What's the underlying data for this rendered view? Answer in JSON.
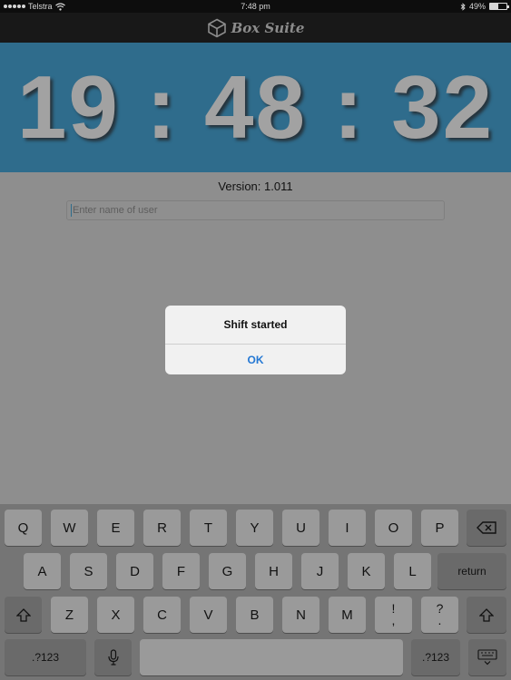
{
  "status_bar": {
    "carrier": "Telstra",
    "time": "7:48 pm",
    "battery": "49%",
    "battery_level": 0.49
  },
  "navbar": {
    "app_name": "Box Suite"
  },
  "clock": {
    "display": "19 : 48 : 32"
  },
  "main": {
    "version": "Version: 1.011",
    "user_placeholder": "Enter name of user"
  },
  "alert": {
    "message": "Shift started",
    "ok_label": "OK"
  },
  "keyboard": {
    "row1": [
      "Q",
      "W",
      "E",
      "R",
      "T",
      "Y",
      "U",
      "I",
      "O",
      "P"
    ],
    "row2": [
      "A",
      "S",
      "D",
      "F",
      "G",
      "H",
      "J",
      "K",
      "L"
    ],
    "row3": [
      "Z",
      "X",
      "C",
      "V",
      "B",
      "N",
      "M"
    ],
    "return_label": "return",
    "exclaim_top": "!",
    "exclaim_bottom": ",",
    "question_top": "?",
    "question_bottom": ".",
    "numbers_left": ".?123",
    "numbers_right": ".?123",
    "icons": {
      "delete": "delete-icon",
      "shift_left": "shift-icon",
      "shift_right": "shift-icon",
      "mic": "microphone-icon",
      "hide": "keyboard-hide-icon"
    }
  },
  "colors": {
    "clock_band": "#2f6c8c",
    "clock_text": "#a2a2a2",
    "alert_button": "#2478d4",
    "background": "#8e8e8e"
  }
}
